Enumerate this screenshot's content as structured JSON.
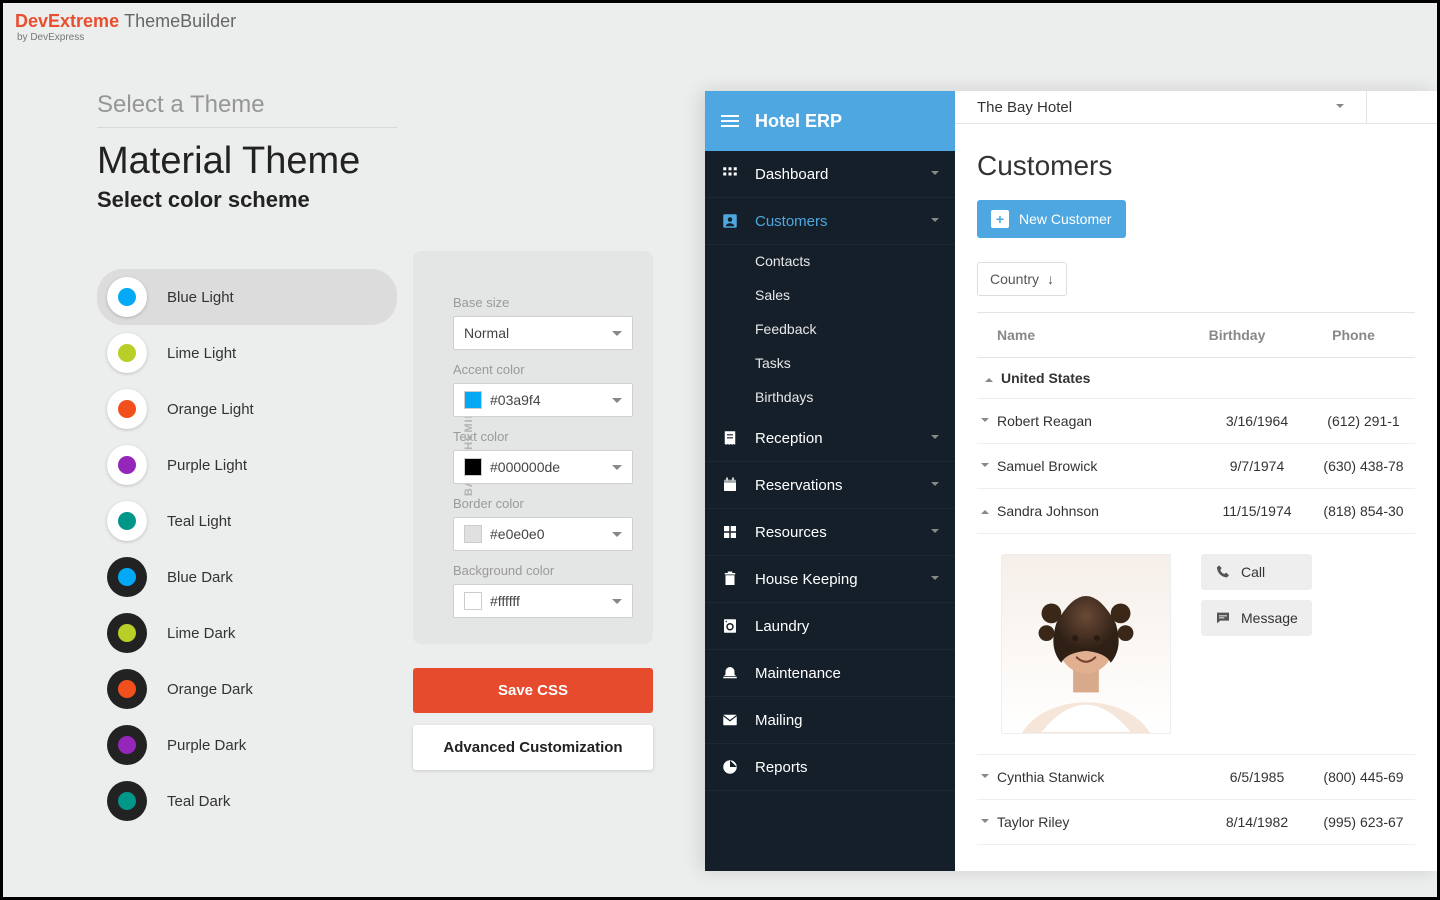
{
  "logo": {
    "brand_left": "Dev",
    "brand_right": "Extreme",
    "product": "ThemeBuilder",
    "byline": "by DevExpress"
  },
  "breadcrumb": "Select a Theme",
  "heading": "Material Theme",
  "subheading": "Select color scheme",
  "schemes": [
    {
      "label": "Blue Light",
      "color": "#03a9f4",
      "ring": "light",
      "selected": true
    },
    {
      "label": "Lime Light",
      "color": "#b8cf27",
      "ring": "light",
      "selected": false
    },
    {
      "label": "Orange Light",
      "color": "#f1501c",
      "ring": "light",
      "selected": false
    },
    {
      "label": "Purple Light",
      "color": "#9426ba",
      "ring": "light",
      "selected": false
    },
    {
      "label": "Teal Light",
      "color": "#009688",
      "ring": "light",
      "selected": false
    },
    {
      "label": "Blue Dark",
      "color": "#03a9f4",
      "ring": "dark",
      "selected": false
    },
    {
      "label": "Lime Dark",
      "color": "#b8cf27",
      "ring": "dark",
      "selected": false
    },
    {
      "label": "Orange Dark",
      "color": "#f1501c",
      "ring": "dark",
      "selected": false
    },
    {
      "label": "Purple Dark",
      "color": "#9426ba",
      "ring": "dark",
      "selected": false
    },
    {
      "label": "Teal Dark",
      "color": "#009688",
      "ring": "dark",
      "selected": false
    }
  ],
  "panel": {
    "tab": "BASE THEMING",
    "fields": {
      "base_size_label": "Base size",
      "base_size_value": "Normal",
      "accent_label": "Accent color",
      "accent_value": "#03a9f4",
      "accent_sw": "#03a9f4",
      "text_label": "Text color",
      "text_value": "#000000de",
      "text_sw": "#000000",
      "border_label": "Border color",
      "border_value": "#e0e0e0",
      "border_sw": "#e0e0e0",
      "bg_label": "Background color",
      "bg_value": "#ffffff",
      "bg_sw": "#ffffff"
    }
  },
  "buttons": {
    "save": "Save CSS",
    "advanced": "Advanced Customization"
  },
  "preview": {
    "app_title": "Hotel ERP",
    "hotel_select": "The Bay Hotel",
    "nav": [
      {
        "label": "Dashboard",
        "icon": "apps",
        "expand": true,
        "active": false
      },
      {
        "label": "Customers",
        "icon": "person-box",
        "expand": true,
        "active": true,
        "children": [
          "Contacts",
          "Sales",
          "Feedback",
          "Tasks",
          "Birthdays"
        ]
      },
      {
        "label": "Reception",
        "icon": "receipt",
        "expand": true,
        "active": false
      },
      {
        "label": "Reservations",
        "icon": "calendar",
        "expand": true,
        "active": false
      },
      {
        "label": "Resources",
        "icon": "grid",
        "expand": true,
        "active": false
      },
      {
        "label": "House Keeping",
        "icon": "trash",
        "expand": true,
        "active": false
      },
      {
        "label": "Laundry",
        "icon": "washer",
        "expand": false,
        "active": false
      },
      {
        "label": "Maintenance",
        "icon": "bell",
        "expand": false,
        "active": false
      },
      {
        "label": "Mailing",
        "icon": "mail",
        "expand": false,
        "active": false
      },
      {
        "label": "Reports",
        "icon": "pie",
        "expand": false,
        "active": false
      }
    ],
    "page_title": "Customers",
    "new_customer": "New Customer",
    "group_chip": "Country",
    "columns": {
      "name": "Name",
      "birthday": "Birthday",
      "phone": "Phone"
    },
    "group_header": "United States",
    "rows": [
      {
        "name": "Robert Reagan",
        "birthday": "3/16/1964",
        "phone": "(612) 291-1"
      },
      {
        "name": "Samuel Browick",
        "birthday": "9/7/1974",
        "phone": "(630) 438-78"
      },
      {
        "name": "Sandra Johnson",
        "birthday": "11/15/1974",
        "phone": "(818) 854-30",
        "expanded": true
      },
      {
        "name": "Cynthia Stanwick",
        "birthday": "6/5/1985",
        "phone": "(800) 445-69"
      },
      {
        "name": "Taylor Riley",
        "birthday": "8/14/1982",
        "phone": "(995) 623-67"
      }
    ],
    "detail_actions": {
      "call": "Call",
      "message": "Message"
    }
  }
}
